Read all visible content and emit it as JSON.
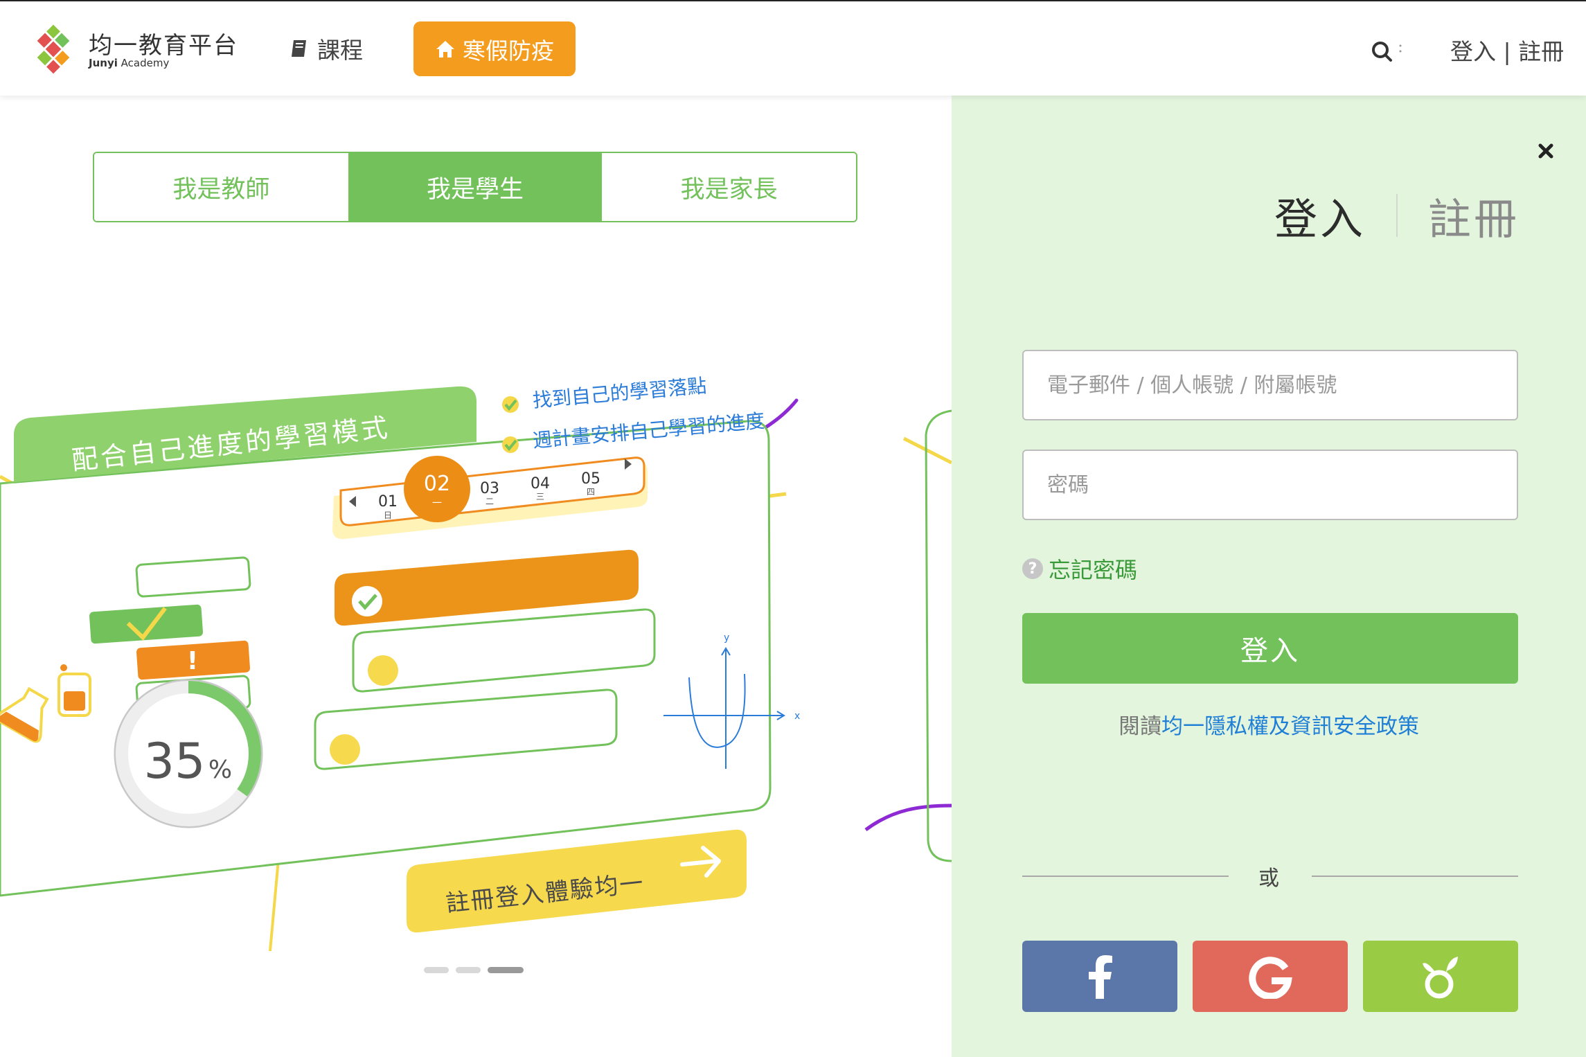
{
  "header": {
    "logo_name": "均一教育平台",
    "logo_sub_bold": "Junyi",
    "logo_sub": "Academy",
    "courses_label": "課程",
    "winter_label": "寒假防疫",
    "login_label": "登入",
    "separator": "|",
    "register_label": "註冊"
  },
  "roles": {
    "teacher": "我是教師",
    "student": "我是學生",
    "parent": "我是家長"
  },
  "illustration": {
    "banner_title": "配合自己進度的學習模式",
    "bullet_1": "找到自己的學習落點",
    "bullet_2": "週計畫安排自己學習的進度",
    "days": [
      {
        "num": "01",
        "sub": "日"
      },
      {
        "num": "02",
        "sub": "一"
      },
      {
        "num": "03",
        "sub": "二"
      },
      {
        "num": "04",
        "sub": "三"
      },
      {
        "num": "05",
        "sub": "四"
      }
    ],
    "progress_value": "35",
    "progress_unit": "%",
    "progress_fraction": 0.35,
    "cta_label": "註冊登入體驗均一",
    "axis_x": "x",
    "axis_y": "y"
  },
  "carousel": {
    "count": 3,
    "active": 2
  },
  "panel": {
    "tab_login": "登入",
    "tab_register": "註冊",
    "email_placeholder": "電子郵件 / 個人帳號 / 附屬帳號",
    "password_placeholder": "密碼",
    "forgot_label": "忘記密碼",
    "login_button": "登入",
    "privacy_prefix": "閱讀",
    "privacy_link": "均一隱私權及資訊安全政策",
    "or_label": "或"
  },
  "social": {
    "facebook_icon": "facebook-icon",
    "google_icon": "google-icon",
    "junyi_icon": "junyi-sprout-icon",
    "facebook_color": "#5b76a8",
    "google_color": "#e1695c",
    "junyi_color": "#9acb44"
  },
  "colors": {
    "brand_green": "#72c15b",
    "accent_orange": "#f39c1e",
    "panel_bg": "#e3f5dd",
    "link_blue": "#1f7fd6"
  }
}
